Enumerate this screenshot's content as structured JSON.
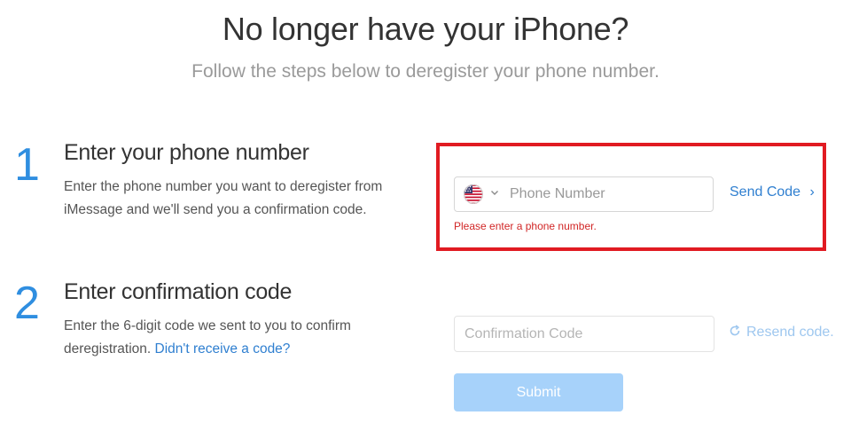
{
  "header": {
    "title": "No longer have your iPhone?",
    "subtitle": "Follow the steps below to deregister your phone number."
  },
  "steps": [
    {
      "number": "1",
      "title": "Enter your phone number",
      "description": "Enter the phone number you want to deregister from iMessage and we'll send you a confirmation code."
    },
    {
      "number": "2",
      "title": "Enter confirmation code",
      "description": "Enter the 6-digit code we sent to you to confirm deregistration.",
      "link": "Didn't receive a code?"
    }
  ],
  "phone_form": {
    "country_icon": "us-flag-icon",
    "dropdown_icon": "chevron-down-icon",
    "placeholder": "Phone Number",
    "value": "",
    "send_label": "Send Code",
    "send_chevron": "›",
    "error": "Please enter a phone number."
  },
  "code_form": {
    "placeholder": "Confirmation Code",
    "value": "",
    "resend_icon": "refresh-icon",
    "resend_label": "Resend code.",
    "submit_label": "Submit"
  },
  "colors": {
    "accent": "#2f8ee0",
    "link": "#2f7fd0",
    "error": "#d12626",
    "highlight": "#e11b22",
    "submit_disabled": "#a7d2fa"
  }
}
